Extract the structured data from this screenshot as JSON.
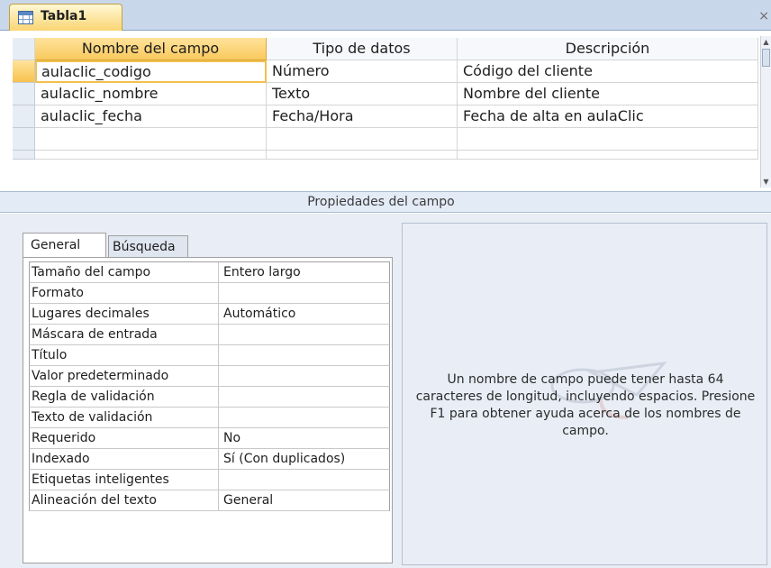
{
  "tab": {
    "title": "Tabla1",
    "icon": "table-icon",
    "close_glyph": "×"
  },
  "grid": {
    "headers": {
      "name": "Nombre del campo",
      "type": "Tipo de datos",
      "description": "Descripción"
    },
    "rows": [
      {
        "name": "aulaclic_codigo",
        "type": "Número",
        "description": "Código del cliente"
      },
      {
        "name": "aulaclic_nombre",
        "type": "Texto",
        "description": "Nombre del cliente"
      },
      {
        "name": "aulaclic_fecha",
        "type": "Fecha/Hora",
        "description": "Fecha de alta en aulaClic"
      },
      {
        "name": "",
        "type": "",
        "description": ""
      },
      {
        "name": "",
        "type": "",
        "description": ""
      }
    ]
  },
  "properties": {
    "band_label": "Propiedades del campo",
    "tabs": {
      "general": "General",
      "busqueda": "Búsqueda"
    },
    "rows": [
      {
        "name": "Tamaño del campo",
        "value": "Entero largo"
      },
      {
        "name": "Formato",
        "value": ""
      },
      {
        "name": "Lugares decimales",
        "value": "Automático"
      },
      {
        "name": "Máscara de entrada",
        "value": ""
      },
      {
        "name": "Título",
        "value": ""
      },
      {
        "name": "Valor predeterminado",
        "value": ""
      },
      {
        "name": "Regla de validación",
        "value": ""
      },
      {
        "name": "Texto de validación",
        "value": ""
      },
      {
        "name": "Requerido",
        "value": "No"
      },
      {
        "name": "Indexado",
        "value": "Sí (Con duplicados)"
      },
      {
        "name": "Etiquetas inteligentes",
        "value": ""
      },
      {
        "name": "Alineación del texto",
        "value": "General"
      }
    ],
    "help_text": "Un nombre de campo puede tener hasta 64 caracteres de longitud, incluyendo espacios. Presione F1 para obtener ayuda acerca de los nombres de campo."
  },
  "colors": {
    "accent": "#f9c95d",
    "tabstrip": "#c9d7ea",
    "pane": "#e9eef6"
  }
}
